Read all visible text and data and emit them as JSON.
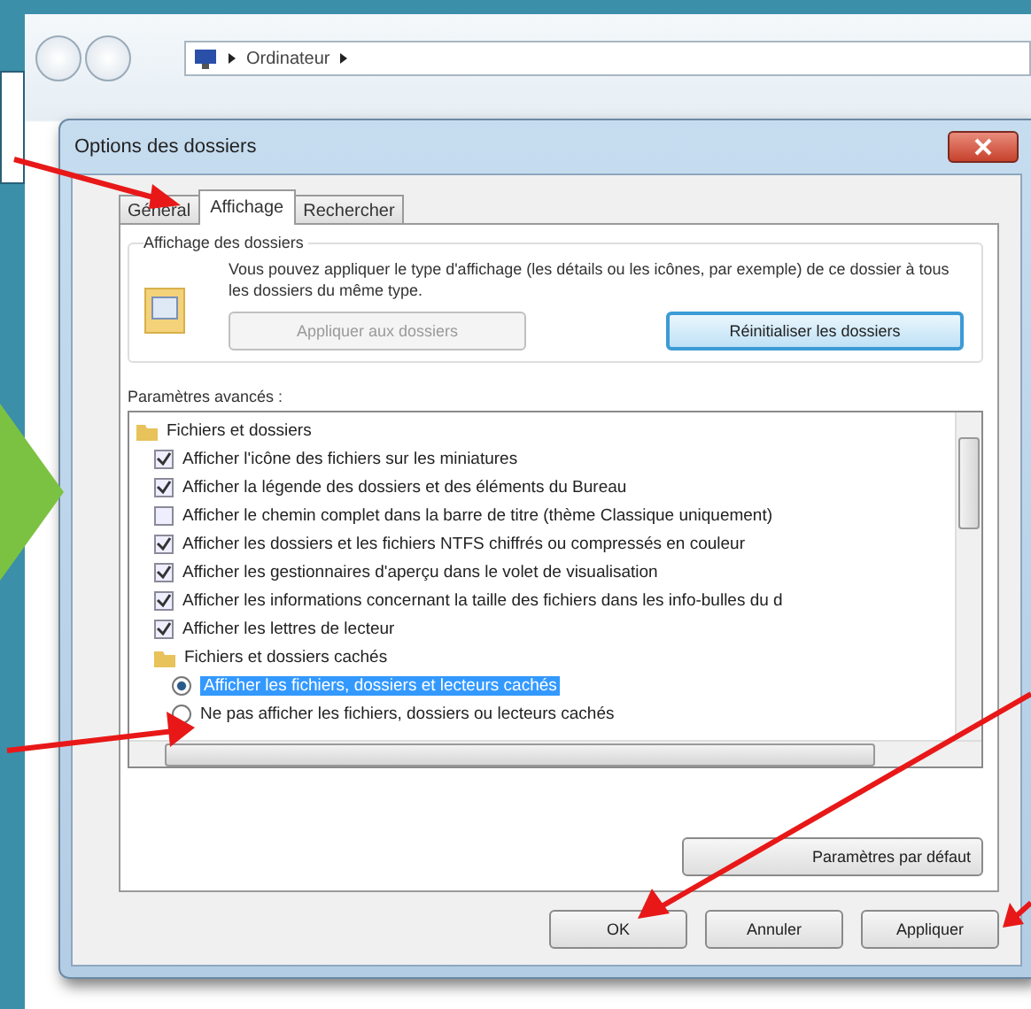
{
  "explorer": {
    "address": "Ordinateur"
  },
  "dialog": {
    "title": "Options des dossiers",
    "tabs": [
      {
        "label": "Général",
        "selected": false
      },
      {
        "label": "Affichage",
        "selected": true
      },
      {
        "label": "Rechercher",
        "selected": false
      }
    ],
    "folder_view": {
      "heading": "Affichage des dossiers",
      "description": "Vous pouvez appliquer le type d'affichage (les détails ou les icônes, par exemple) de ce dossier à tous les dossiers du même type.",
      "buttons": [
        {
          "label": "Appliquer aux dossiers",
          "disabled": true
        },
        {
          "label": "Réinitialiser les dossiers",
          "disabled": false
        }
      ]
    },
    "advanced": {
      "label": "Paramètres avancés :",
      "items": [
        {
          "kind": "folder",
          "label": "Fichiers et dossiers",
          "children": [
            {
              "kind": "checkbox",
              "label": "Afficher l'icône des fichiers sur les miniatures",
              "checked": true
            },
            {
              "kind": "checkbox",
              "label": "Afficher la légende des dossiers et des éléments du Bureau",
              "checked": true
            },
            {
              "kind": "checkbox",
              "label": "Afficher le chemin complet dans la barre de titre (thème Classique uniquement)",
              "checked": false
            },
            {
              "kind": "checkbox",
              "label": "Afficher les dossiers et les fichiers NTFS chiffrés ou compressés en couleur",
              "checked": true
            },
            {
              "kind": "checkbox",
              "label": "Afficher les gestionnaires d'aperçu dans le volet de visualisation",
              "checked": true
            },
            {
              "kind": "checkbox",
              "label": "Afficher les informations concernant la taille des fichiers dans les info-bulles du d",
              "checked": true
            },
            {
              "kind": "checkbox",
              "label": "Afficher les lettres de lecteur",
              "checked": true
            },
            {
              "kind": "folder",
              "label": "Fichiers et dossiers cachés",
              "children": [
                {
                  "kind": "radio",
                  "label": "Afficher les fichiers, dossiers et lecteurs cachés",
                  "selected": true
                },
                {
                  "kind": "radio",
                  "label": "Ne pas afficher les fichiers, dossiers ou lecteurs cachés",
                  "selected": false
                }
              ]
            }
          ]
        }
      ]
    },
    "default_button": "Paramètres par défaut",
    "buttons": [
      "OK",
      "Annuler",
      "Appliquer"
    ]
  }
}
